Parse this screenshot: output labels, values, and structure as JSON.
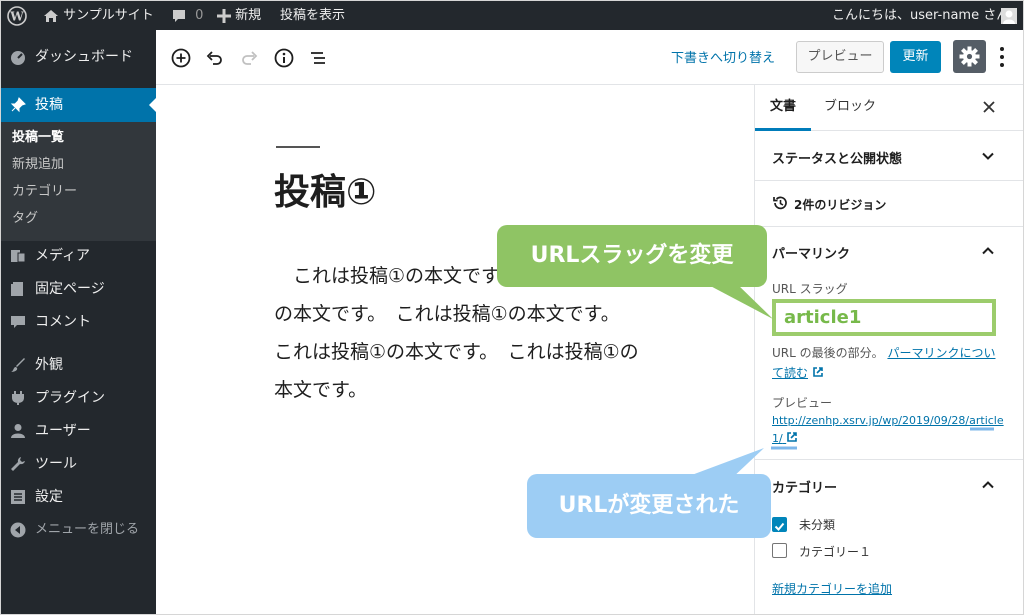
{
  "adminbar": {
    "site_name": "サンプルサイト",
    "comment_count": "0",
    "new_label": "新規",
    "view_post_label": "投稿を表示",
    "greeting": "こんにちは、user-name さん"
  },
  "sidebar": {
    "dashboard": "ダッシュボード",
    "posts": "投稿",
    "submenu": [
      "投稿一覧",
      "新規追加",
      "カテゴリー",
      "タグ"
    ],
    "media": "メディア",
    "pages": "固定ページ",
    "comments": "コメント",
    "appearance": "外観",
    "plugins": "プラグイン",
    "users": "ユーザー",
    "tools": "ツール",
    "settings": "設定",
    "collapse": "メニューを閉じる"
  },
  "toolbar": {
    "switch_to_draft": "下書きへ切り替え",
    "preview": "プレビュー",
    "update": "更新"
  },
  "editor": {
    "title": "投稿①",
    "body": "　これは投稿①の本文です。　これは投稿①の本文です。　これは投稿①の本文です。　これは投稿①の本文です。　これは投稿①の本文です。"
  },
  "panel": {
    "tab_document": "文書",
    "tab_block": "ブロック",
    "status_visibility": "ステータスと公開状態",
    "revisions": "2件のリビジョン",
    "permalink": "パーマリンク",
    "url_slug_label": "URL スラッグ",
    "url_slug_value": "article1",
    "slug_help_prefix": "URL の最後の部分。",
    "slug_help_link": "パーマリンクについて読む",
    "preview_label": "プレビュー",
    "preview_url": "http://zenhp.xsrv.jp/wp/2019/09/28/article1/",
    "categories": "カテゴリー",
    "category_items": [
      {
        "label": "未分類",
        "checked": true
      },
      {
        "label": "カテゴリー１",
        "checked": false
      }
    ],
    "add_category": "新規カテゴリーを追加"
  },
  "annotations": {
    "slug_changed": "URLスラッグを変更",
    "url_changed": "URLが変更された"
  },
  "colors": {
    "admin_dark": "#23282d",
    "accent_blue": "#0085ba",
    "callout_green": "#8fc464",
    "callout_blue": "#9dcdf4"
  }
}
